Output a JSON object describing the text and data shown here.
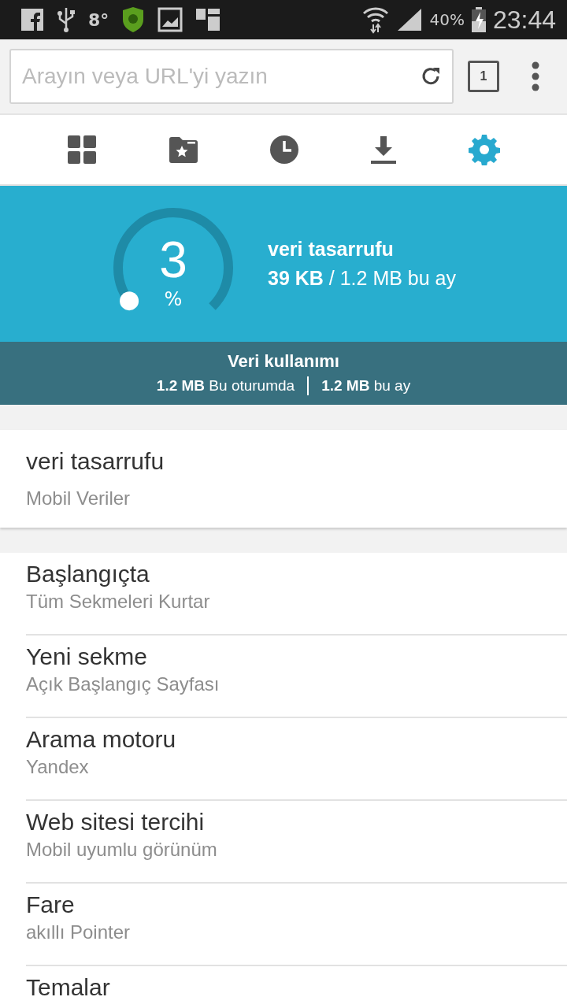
{
  "status_bar": {
    "temperature": "8°",
    "battery": "40%",
    "time": "23:44"
  },
  "address_bar": {
    "placeholder": "Arayın veya URL'yi yazın",
    "tab_count": "1"
  },
  "tabs": [
    {
      "selected": false
    },
    {
      "selected": false
    },
    {
      "selected": false
    },
    {
      "selected": false
    },
    {
      "selected": true
    }
  ],
  "savings": {
    "percent": "3",
    "unit": "%",
    "title": "veri tasarrufu",
    "summary": "**39 KB** / 1.2 MB bu ay"
  },
  "usage": {
    "title": "Veri kullanımı",
    "session": "**1.2 MB** Bu oturumda",
    "month": "**1.2 MB** bu ay"
  },
  "data_saver": {
    "title": "veri tasarrufu",
    "value": "Mobil Veriler"
  },
  "settings": [
    {
      "title": "Başlangıçta",
      "value": "Tüm Sekmeleri Kurtar"
    },
    {
      "title": "Yeni sekme",
      "value": "Açık Başlangıç Sayfası"
    },
    {
      "title": "Arama motoru",
      "value": "Yandex"
    },
    {
      "title": "Web sitesi tercihi",
      "value": "Mobil uyumlu görünüm"
    },
    {
      "title": "Fare",
      "value": "akıllı Pointer"
    },
    {
      "title": "Temalar"
    }
  ]
}
